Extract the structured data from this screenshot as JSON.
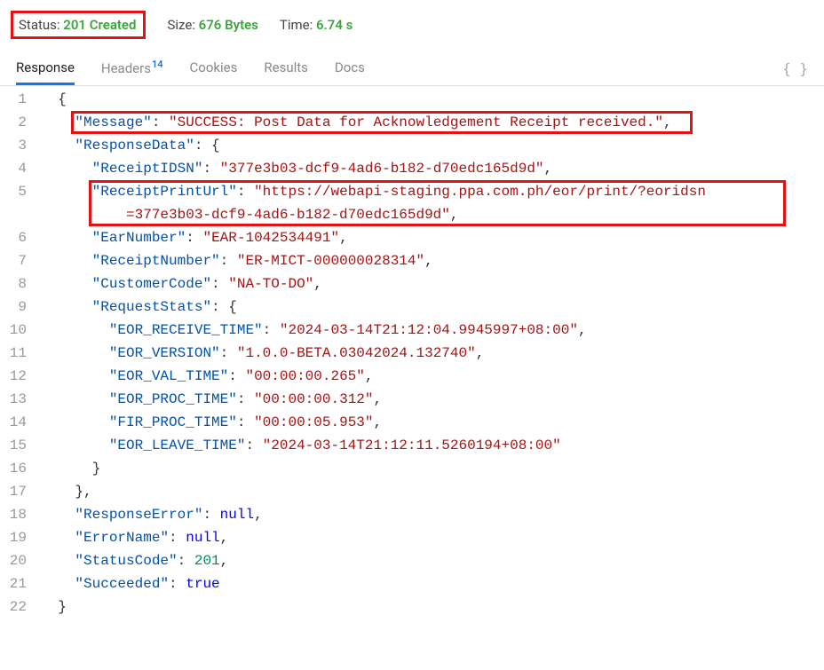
{
  "status_bar": {
    "status_label": "Status:",
    "status_value": "201 Created",
    "size_label": "Size:",
    "size_value": "676 Bytes",
    "time_label": "Time:",
    "time_value": "6.74 s"
  },
  "tabs": {
    "response": "Response",
    "headers": "Headers",
    "headers_count": "14",
    "cookies": "Cookies",
    "results": "Results",
    "docs": "Docs",
    "braces_icon": "{ }"
  },
  "json": {
    "message_key": "Message",
    "message_val": "SUCCESS: Post Data for Acknowledgement Receipt received.",
    "responsedata_key": "ResponseData",
    "receiptidsn_key": "ReceiptIDSN",
    "receiptidsn_val": "377e3b03-dcf9-4ad6-b182-d70edc165d9d",
    "receiptprinturl_key": "ReceiptPrintUrl",
    "receiptprinturl_val_1": "https://webapi-staging.ppa.com.ph/eor/print/?eoridsn",
    "receiptprinturl_val_2": "=377e3b03-dcf9-4ad6-b182-d70edc165d9d",
    "earnumber_key": "EarNumber",
    "earnumber_val": "EAR-1042534491",
    "receiptnumber_key": "ReceiptNumber",
    "receiptnumber_val": "ER-MICT-000000028314",
    "customercode_key": "CustomerCode",
    "customercode_val": "NA-TO-DO",
    "requeststats_key": "RequestStats",
    "eor_receive_time_key": "EOR_RECEIVE_TIME",
    "eor_receive_time_val": "2024-03-14T21:12:04.9945997+08:00",
    "eor_version_key": "EOR_VERSION",
    "eor_version_val": "1.0.0-BETA.03042024.132740",
    "eor_val_time_key": "EOR_VAL_TIME",
    "eor_val_time_val": "00:00:00.265",
    "eor_proc_time_key": "EOR_PROC_TIME",
    "eor_proc_time_val": "00:00:00.312",
    "fir_proc_time_key": "FIR_PROC_TIME",
    "fir_proc_time_val": "00:00:05.953",
    "eor_leave_time_key": "EOR_LEAVE_TIME",
    "eor_leave_time_val": "2024-03-14T21:12:11.5260194+08:00",
    "responseerror_key": "ResponseError",
    "errorname_key": "ErrorName",
    "statuscode_key": "StatusCode",
    "statuscode_val": "201",
    "succeeded_key": "Succeeded",
    "succeeded_val": "true",
    "null_val": "null"
  },
  "lines": [
    "1",
    "2",
    "3",
    "4",
    "5",
    "6",
    "7",
    "8",
    "9",
    "10",
    "11",
    "12",
    "13",
    "14",
    "15",
    "16",
    "17",
    "18",
    "19",
    "20",
    "21",
    "22"
  ]
}
